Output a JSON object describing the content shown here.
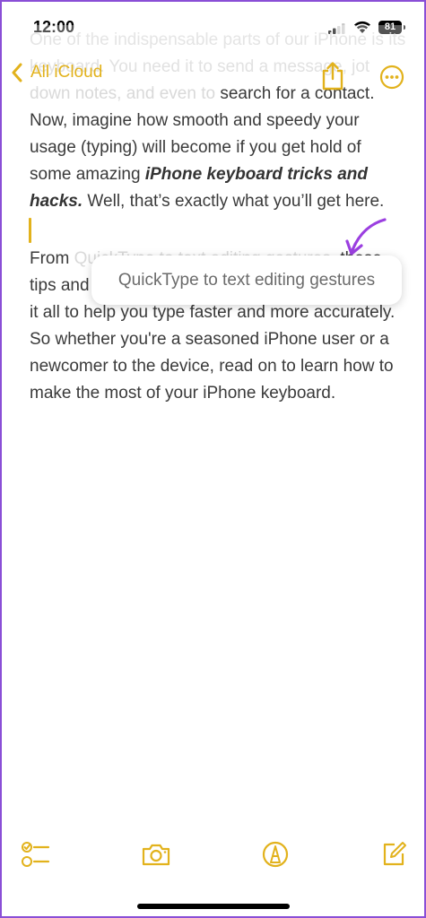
{
  "status_bar": {
    "time": "12:00",
    "battery": "81"
  },
  "nav": {
    "back_label": "All iCloud"
  },
  "note": {
    "para1_faded": "One of the indispensable parts of our iPhone is its keyboard. You need it to send a message, jot down notes, and even to search for a contact.",
    "para1_line": "search for a contact. Now, imagine how smooth and speedy your usage (typing) will become if you get hold of some amazing",
    "para1_bold": "iPhone keyboard tricks and hacks.",
    "para1_end": " Well, that’s exactly what you’ll get here.",
    "para2_start": "From ",
    "para2_faded": "QuickType to text editing gestures,",
    "para2_rest": " these tips and tricks for iPhone keyboard have covered it all to help you type faster and more accurately. So whether you're a seasoned iPhone user or a newcomer to the device, read on to learn how to make the most of your iPhone keyboard."
  },
  "tooltip": {
    "text": "QuickType to text editing gestures"
  },
  "colors": {
    "accent": "#e2b21c",
    "arrow": "#9b3fe0",
    "border": "#8a4fd6"
  },
  "toolbar": {
    "icons": [
      "checklist-icon",
      "camera-icon",
      "markup-icon",
      "compose-icon"
    ]
  }
}
